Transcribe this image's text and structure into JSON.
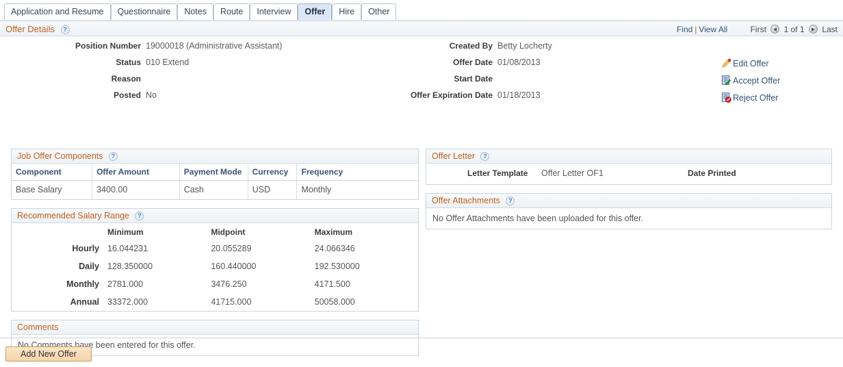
{
  "tabs": [
    {
      "label": "Application and Resume",
      "selected": false
    },
    {
      "label": "Questionnaire",
      "selected": false
    },
    {
      "label": "Notes",
      "selected": false
    },
    {
      "label": "Route",
      "selected": false
    },
    {
      "label": "Interview",
      "selected": false
    },
    {
      "label": "Offer",
      "selected": true
    },
    {
      "label": "Hire",
      "selected": false
    },
    {
      "label": "Other",
      "selected": false
    }
  ],
  "offer_details": {
    "title": "Offer Details",
    "help": "?",
    "find_label": "Find",
    "separator": "|",
    "view_all_label": "View All",
    "first_label": "First",
    "counter": "1 of 1",
    "last_label": "Last"
  },
  "actions": [
    {
      "label": "Edit Offer",
      "icon": "pencil-icon"
    },
    {
      "label": "Accept Offer",
      "icon": "accept-document-icon"
    },
    {
      "label": "Reject Offer",
      "icon": "reject-document-icon"
    }
  ],
  "fields_left": [
    {
      "label": "Position Number",
      "value": "19000018 (Administrative Assistant)"
    },
    {
      "label": "Status",
      "value": "010 Extend"
    },
    {
      "label": "Reason",
      "value": ""
    },
    {
      "label": "Posted",
      "value": "No"
    }
  ],
  "fields_mid": [
    {
      "label": "Created By",
      "value": "Betty Locherty"
    },
    {
      "label": "Offer Date",
      "value": "01/08/2013"
    },
    {
      "label": "Start Date",
      "value": ""
    },
    {
      "label": "Offer Expiration Date",
      "value": "01/18/2013"
    }
  ],
  "job_offer_components": {
    "title": "Job Offer Components",
    "help": "?",
    "columns": [
      "Component",
      "Offer Amount",
      "Payment Mode",
      "Currency",
      "Frequency"
    ],
    "rows": [
      [
        "Base Salary",
        "3400.00",
        "Cash",
        "USD",
        "Monthly"
      ]
    ]
  },
  "recommended_salary_range": {
    "title": "Recommended Salary Range",
    "help": "?",
    "columns": [
      "",
      "Minimum",
      "Midpoint",
      "Maximum"
    ],
    "rows": [
      {
        "label": "Hourly",
        "minimum": "16.044231",
        "midpoint": "20.055289",
        "maximum": "24.066346"
      },
      {
        "label": "Daily",
        "minimum": "128.350000",
        "midpoint": "160.440000",
        "maximum": "192.530000"
      },
      {
        "label": "Monthly",
        "minimum": "2781.000",
        "midpoint": "3476.250",
        "maximum": "4171.500"
      },
      {
        "label": "Annual",
        "minimum": "33372.000",
        "midpoint": "41715.000",
        "maximum": "50058.000"
      }
    ]
  },
  "comments": {
    "title": "Comments",
    "empty_text": "No Comments have been entered for this offer."
  },
  "offer_letter": {
    "title": "Offer Letter",
    "help": "?",
    "letter_template_label": "Letter Template",
    "letter_template_value": "Offer Letter OF1",
    "date_printed_label": "Date Printed",
    "date_printed_value": ""
  },
  "offer_attachments": {
    "title": "Offer Attachments",
    "help": "?",
    "empty_text": "No Offer Attachments have been uploaded for this offer."
  },
  "footer": {
    "add_new_offer_label": "Add New Offer"
  }
}
